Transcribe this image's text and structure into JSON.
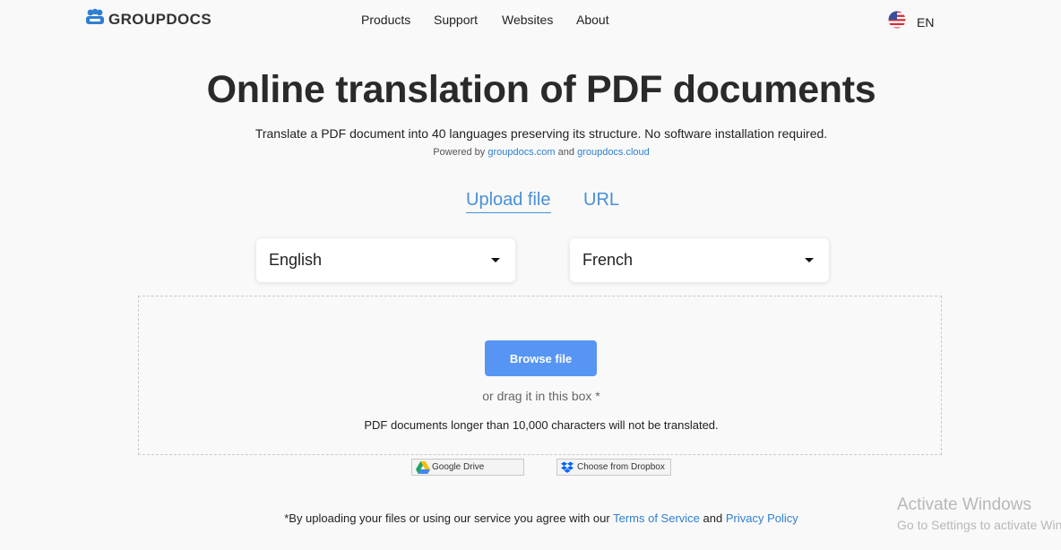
{
  "header": {
    "logo_text": "GROUPDOCS",
    "nav": [
      "Products",
      "Support",
      "Websites",
      "About"
    ],
    "language_code": "EN"
  },
  "hero": {
    "title": "Online translation of PDF documents",
    "subtitle": "Translate a PDF document into 40 languages preserving its structure. No software installation required.",
    "powered_prefix": "Powered by",
    "powered_link1": "groupdocs.com",
    "powered_and": "and",
    "powered_link2": "groupdocs.cloud"
  },
  "tabs": {
    "upload": "Upload file",
    "url": "URL",
    "active": "upload"
  },
  "languages": {
    "source": "English",
    "target": "French"
  },
  "dropzone": {
    "browse_label": "Browse file",
    "drag_hint": "or drag it in this box *",
    "limit_note": "PDF documents longer than 10,000 characters will not be translated."
  },
  "cloud": {
    "gdrive_label": "Google Drive",
    "dropbox_label": "Choose from Dropbox"
  },
  "footer": {
    "terms_prefix": "*By uploading your files or using our service you agree with our",
    "terms_link": "Terms of Service",
    "terms_and": "and",
    "privacy_link": "Privacy Policy"
  },
  "watermark": {
    "title": "Activate Windows",
    "subtitle": "Go to Settings to activate Windows."
  },
  "colors": {
    "accent": "#5795f5",
    "link": "#2f7fd1",
    "tab": "#4a8fd6",
    "background": "#f9f9f9"
  },
  "icons": [
    "groupdocs-logo-icon",
    "us-flag-icon",
    "chevron-down-icon",
    "google-drive-icon",
    "dropbox-icon"
  ]
}
